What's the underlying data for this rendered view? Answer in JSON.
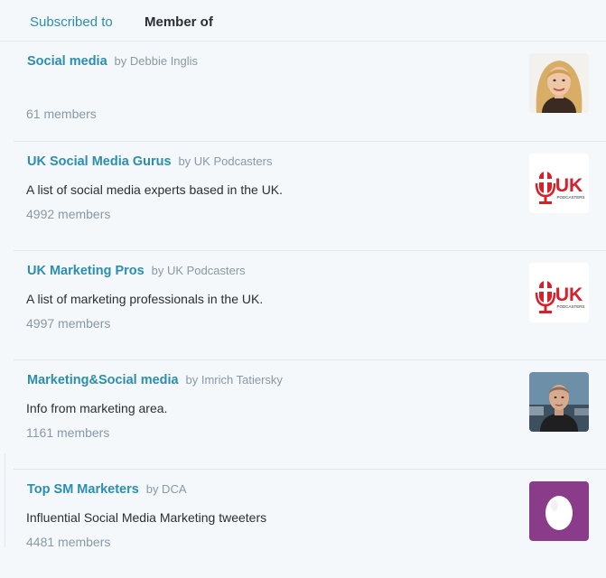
{
  "tabs": {
    "subscribed": "Subscribed to",
    "member": "Member of"
  },
  "lists": [
    {
      "name": "Social media",
      "by": "by Debbie Inglis",
      "description": "",
      "members": "61 members",
      "avatar": "woman-blonde-portrait-avatar"
    },
    {
      "name": "UK Social Media Gurus",
      "by": "by UK Podcasters",
      "description": "A list of social media experts based in the UK.",
      "members": "4992 members",
      "avatar": "uk-podcasters-logo"
    },
    {
      "name": "UK Marketing Pros",
      "by": "by UK Podcasters",
      "description": "A list of marketing professionals in the UK.",
      "members": "4997 members",
      "avatar": "uk-podcasters-logo"
    },
    {
      "name": "Marketing&Social media",
      "by": "by Imrich Tatiersky",
      "description": "Info from marketing area.",
      "members": "1161 members",
      "avatar": "man-portrait-avatar"
    },
    {
      "name": "Top SM Marketers",
      "by": "by DCA",
      "description": "Influential Social Media Marketing tweeters",
      "members": "4481 members",
      "avatar": "default-egg-avatar"
    }
  ],
  "logo_text": {
    "uk": "UK",
    "podcasters": "PODCASTERS"
  },
  "colors": {
    "link": "#2b8db0",
    "muted": "#8899a6",
    "text": "#292f33",
    "background": "#f5f8fa",
    "uk_red": "#d6202a",
    "egg_purple": "#8a3c8a"
  }
}
